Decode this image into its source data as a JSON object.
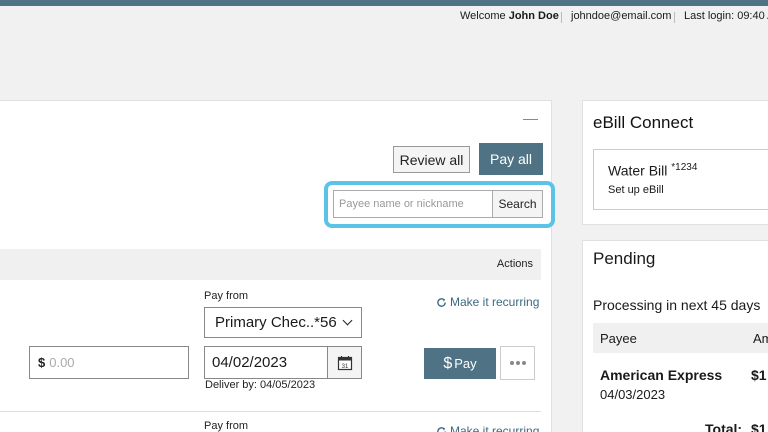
{
  "header": {
    "welcome_prefix": "Welcome",
    "user_name": "John Doe",
    "email": "johndoe@email.com",
    "last_login": "Last login: 09:40 A"
  },
  "toolbar": {
    "review_all_label": "Review all",
    "pay_all_label": "Pay all"
  },
  "search": {
    "placeholder": "Payee name or nickname",
    "button_label": "Search"
  },
  "table": {
    "actions_header": "Actions"
  },
  "payment_row": {
    "pay_from_label": "Pay from",
    "pay_from_value": "Primary Chec..*56",
    "recurring_label": "Make it recurring",
    "amount_symbol": "$",
    "amount_placeholder": "0.00",
    "date_value": "04/02/2023",
    "deliver_by": "Deliver by: 04/05/2023",
    "pay_button_symbol": "$",
    "pay_button_label": "Pay",
    "calendar_day": "31"
  },
  "payment_row_2": {
    "pay_from_label": "Pay from",
    "recurring_label": "Make it recurring"
  },
  "ebill": {
    "title": "eBill Connect",
    "bill_name": "Water Bill",
    "bill_account": "*1234",
    "setup_label": "Set up eBill"
  },
  "pending": {
    "title": "Pending",
    "processing_label": "Processing in next 45 days",
    "col_payee": "Payee",
    "col_amount": "Am",
    "rows": [
      {
        "payee": "American Express",
        "date": "04/03/2023",
        "amount": "$1"
      }
    ],
    "total_label": "Total:",
    "total_amount": "$1"
  },
  "colors": {
    "accent": "#4f7384",
    "highlight": "#5bc3e8",
    "link": "#3b6a80"
  }
}
